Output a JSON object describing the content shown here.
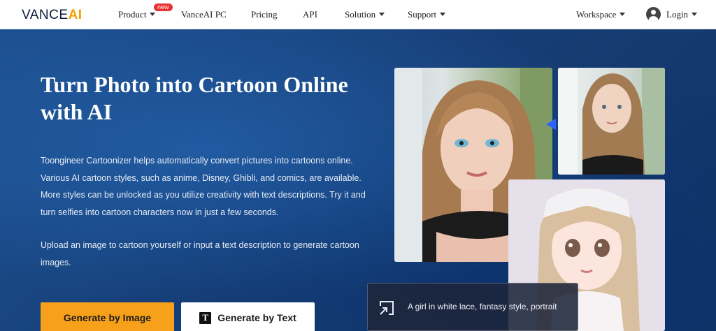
{
  "nav": {
    "logo_main": "VANCE",
    "logo_accent": "AI",
    "items": [
      {
        "label": "Product",
        "has_caret": true
      },
      {
        "label": "VanceAI PC",
        "has_caret": false
      },
      {
        "label": "Pricing",
        "has_caret": false
      },
      {
        "label": "API",
        "has_caret": false
      },
      {
        "label": "Solution",
        "has_caret": true
      },
      {
        "label": "Support",
        "has_caret": true
      }
    ],
    "new_badge": "new",
    "workspace": "Workspace",
    "login": "Login"
  },
  "hero": {
    "title": "Turn Photo into Cartoon Online with AI",
    "description": "Toongineer Cartoonizer helps automatically convert pictures into cartoons online. Various AI cartoon styles, such as anime, Disney, Ghibli, and comics, are available. More styles can be unlocked as you utilize creativity with text descriptions. Try it and turn selfies into cartoon characters now in just a few seconds.",
    "description2": "Upload an image to cartoon yourself or input a text description to generate cartoon images.",
    "btn_image": "Generate by Image",
    "btn_text": "Generate by Text",
    "prompt_text": "A girl in white lace, fantasy style, portrait"
  },
  "colors": {
    "accent": "#f7a11a",
    "hero_bg": "#1c4f8f",
    "badge": "#e8302f"
  }
}
